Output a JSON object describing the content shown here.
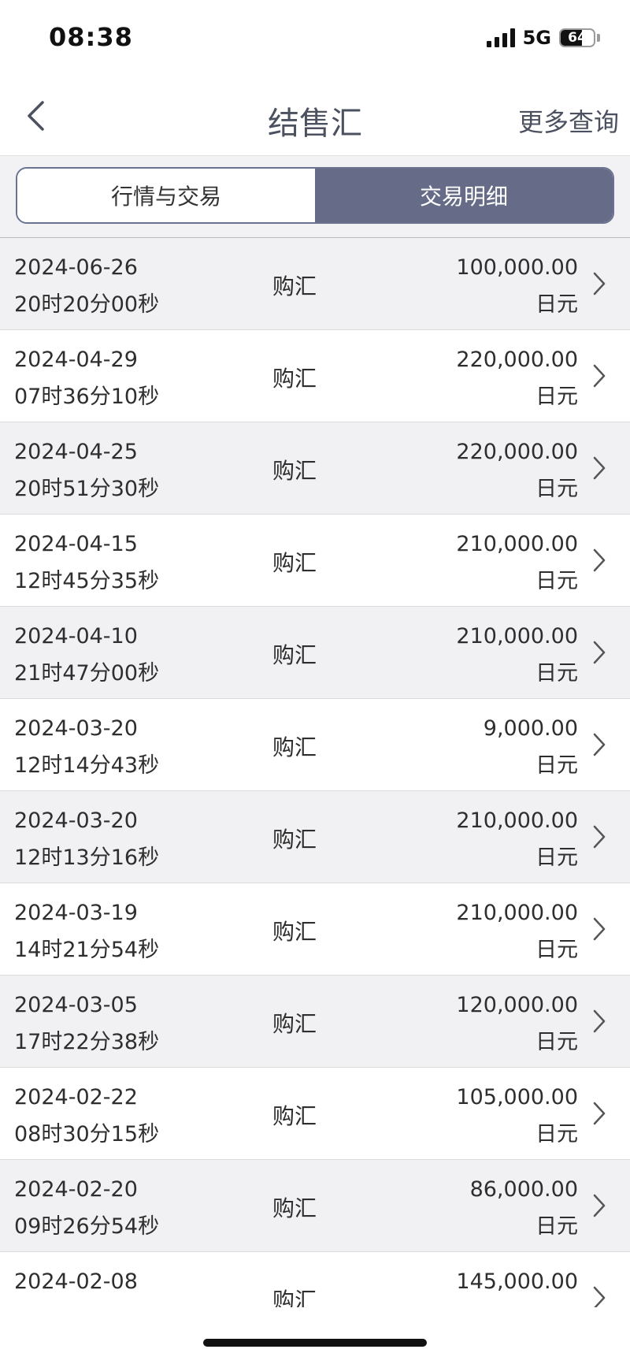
{
  "status_bar": {
    "time": "08:38",
    "network": "5G",
    "battery": "64",
    "battery_level_pct": 64
  },
  "nav": {
    "title": "结售汇",
    "more_label": "更多查询",
    "back_icon": "chevron-left-icon"
  },
  "tabs": [
    {
      "label": "行情与交易",
      "active": false
    },
    {
      "label": "交易明细",
      "active": true
    }
  ],
  "colors": {
    "accent": "#666c87",
    "title_text": "#4c5160",
    "row_shade": "#f1f1f3"
  },
  "transactions": [
    {
      "date": "2024-06-26",
      "time": "20时20分00秒",
      "type": "购汇",
      "amount": "100,000.00",
      "currency": "日元"
    },
    {
      "date": "2024-04-29",
      "time": "07时36分10秒",
      "type": "购汇",
      "amount": "220,000.00",
      "currency": "日元"
    },
    {
      "date": "2024-04-25",
      "time": "20时51分30秒",
      "type": "购汇",
      "amount": "220,000.00",
      "currency": "日元"
    },
    {
      "date": "2024-04-15",
      "time": "12时45分35秒",
      "type": "购汇",
      "amount": "210,000.00",
      "currency": "日元"
    },
    {
      "date": "2024-04-10",
      "time": "21时47分00秒",
      "type": "购汇",
      "amount": "210,000.00",
      "currency": "日元"
    },
    {
      "date": "2024-03-20",
      "time": "12时14分43秒",
      "type": "购汇",
      "amount": "9,000.00",
      "currency": "日元"
    },
    {
      "date": "2024-03-20",
      "time": "12时13分16秒",
      "type": "购汇",
      "amount": "210,000.00",
      "currency": "日元"
    },
    {
      "date": "2024-03-19",
      "time": "14时21分54秒",
      "type": "购汇",
      "amount": "210,000.00",
      "currency": "日元"
    },
    {
      "date": "2024-03-05",
      "time": "17时22分38秒",
      "type": "购汇",
      "amount": "120,000.00",
      "currency": "日元"
    },
    {
      "date": "2024-02-22",
      "time": "08时30分15秒",
      "type": "购汇",
      "amount": "105,000.00",
      "currency": "日元"
    },
    {
      "date": "2024-02-20",
      "time": "09时26分54秒",
      "type": "购汇",
      "amount": "86,000.00",
      "currency": "日元"
    },
    {
      "date": "2024-02-08",
      "time": "",
      "type": "购汇",
      "amount": "145,000.00",
      "currency": ""
    }
  ]
}
